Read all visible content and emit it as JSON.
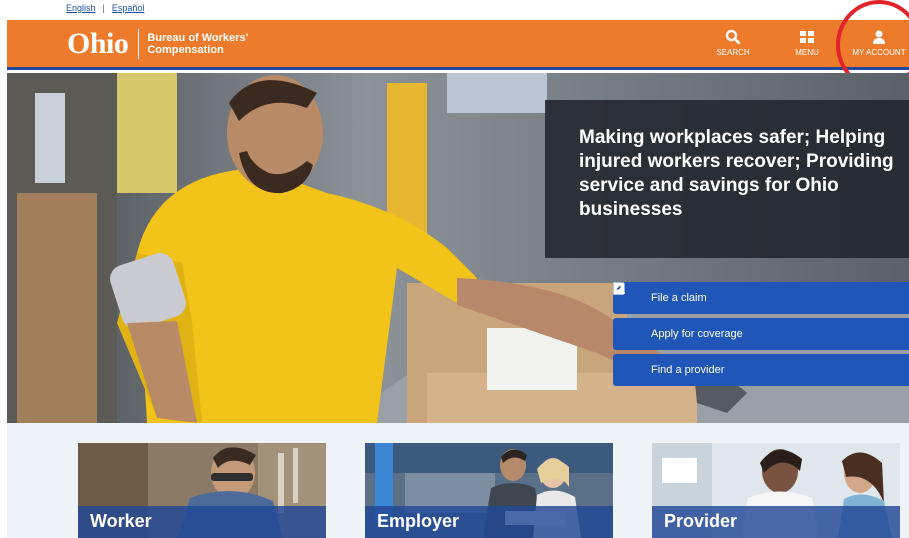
{
  "lang": {
    "english": "English",
    "separator": "|",
    "espanol": "Español"
  },
  "header": {
    "logo_text": "Ohio",
    "org_line1": "Bureau of Workers'",
    "org_line2": "Compensation",
    "search_label": "SEARCH",
    "menu_label": "MENU",
    "account_label": "MY ACCOUNT"
  },
  "hero": {
    "tagline": "Making workplaces safer; Helping injured workers recover; Providing service and savings for Ohio businesses",
    "actions": [
      {
        "label": "File a claim",
        "icon": "document-icon"
      },
      {
        "label": "Apply for coverage",
        "icon": "pencil-icon"
      },
      {
        "label": "Find a provider",
        "icon": "search-icon"
      }
    ]
  },
  "cards": [
    {
      "label": "Worker"
    },
    {
      "label": "Employer"
    },
    {
      "label": "Provider"
    }
  ],
  "colors": {
    "brand_orange": "#ee7b2c",
    "brand_blue": "#1f56b8",
    "annotation_red": "#e2232b"
  }
}
